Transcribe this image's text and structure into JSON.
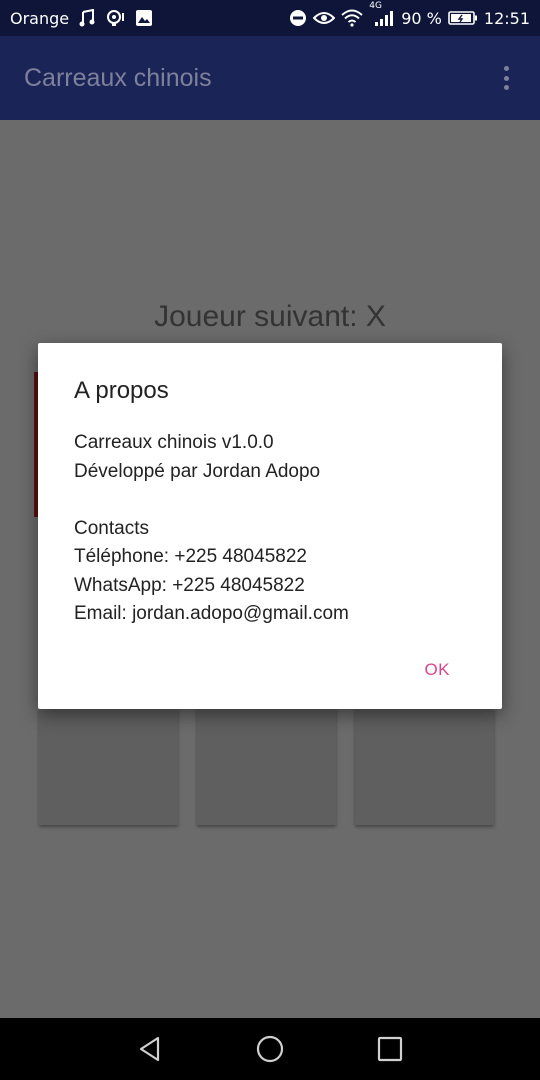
{
  "status_bar": {
    "carrier": "Orange",
    "battery": "90 %",
    "time": "12:51",
    "network": "4G"
  },
  "app_bar": {
    "title": "Carreaux chinois"
  },
  "game": {
    "next_player": "Joueur suivant: X"
  },
  "dialog": {
    "title": "A propos",
    "lines": [
      "Carreaux chinois v1.0.0",
      "Développé par Jordan Adopo",
      "",
      "Contacts",
      "Téléphone: +225 48045822",
      "WhatsApp: +225 48045822",
      "Email: jordan.adopo@gmail.com"
    ],
    "ok_label": "OK"
  },
  "colors": {
    "status_bar": "#0e1538",
    "app_bar": "#1b2457",
    "accent": "#d9468b"
  },
  "icons": [
    "music-note-icon",
    "hotspot-icon",
    "image-icon",
    "do-not-disturb-icon",
    "eye-icon",
    "wifi-icon",
    "signal-icon",
    "battery-icon",
    "overflow-menu-icon",
    "back-icon",
    "home-icon",
    "recents-icon"
  ]
}
